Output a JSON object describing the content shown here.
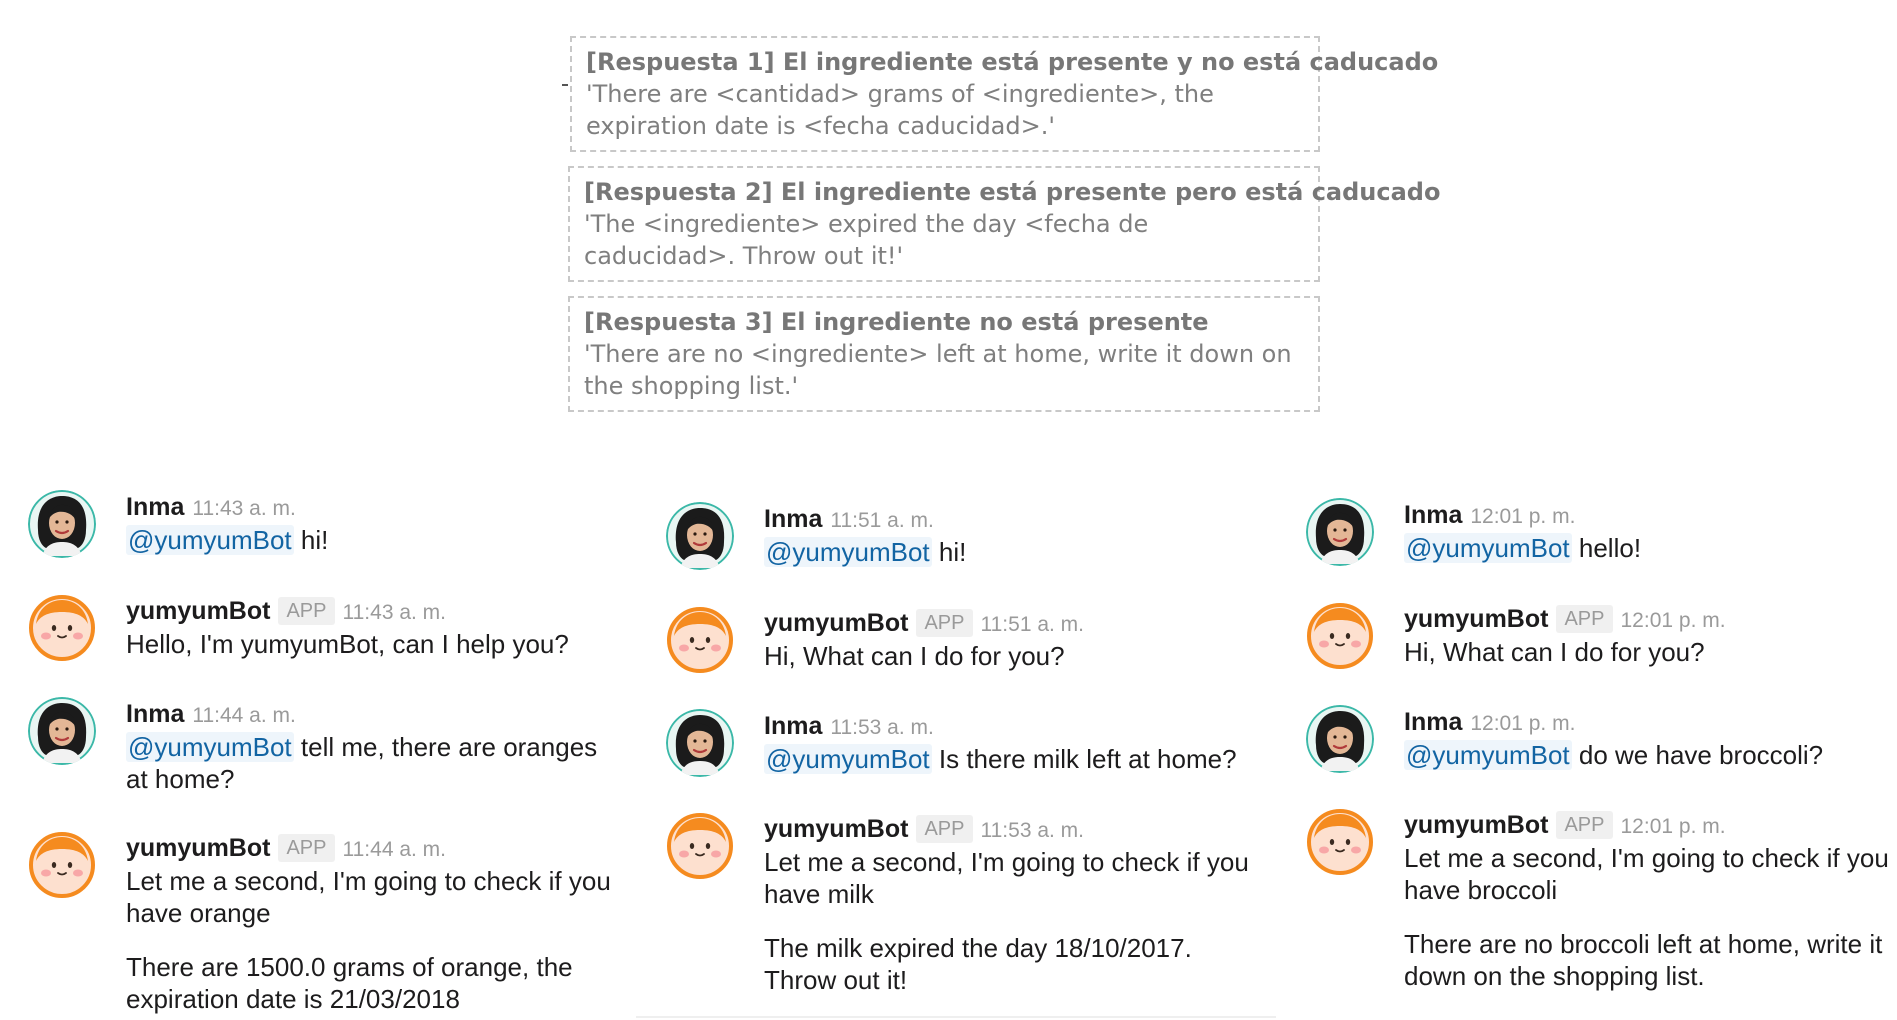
{
  "responses": [
    {
      "title": "[Respuesta 1] El ingrediente está presente y no está caducado",
      "text": "'There are <cantidad> grams of <ingrediente>, the expiration date is <fecha caducidad>.'"
    },
    {
      "title": "[Respuesta 2] El ingrediente está presente pero está caducado",
      "text": "'The <ingrediente> expired the day <fecha de caducidad>. Throw out it!'"
    },
    {
      "title": "[Respuesta 3] El ingrediente no está presente",
      "text": "'There are no <ingrediente> left at home, write it down on the shopping list.'"
    }
  ],
  "colors": {
    "mention": "#1264a3",
    "mention_bg": "#eef5fb",
    "bot_avatar_ring": "#f58b1f",
    "user_avatar_ring": "#3bb8a8"
  },
  "chats": [
    {
      "messages": [
        {
          "avatar": "inma-avatar-icon",
          "name": "Inma",
          "time": "11:43 a. m.",
          "mention": "@yumyumBot",
          "text": " hi!"
        },
        {
          "avatar": "yumyumbot-avatar-icon",
          "name": "yumyumBot",
          "badge": "APP",
          "time": "11:43 a. m.",
          "text": "Hello, I'm yumyumBot, can I help you?"
        },
        {
          "avatar": "inma-avatar-icon",
          "name": "Inma",
          "time": "11:44 a. m.",
          "mention": "@yumyumBot",
          "text": " tell me, there are oranges at home?"
        },
        {
          "avatar": "yumyumbot-avatar-icon",
          "name": "yumyumBot",
          "badge": "APP",
          "time": "11:44 a. m.",
          "text": "Let me a second, I'm going to check if you have orange",
          "text2": "There are 1500.0 grams of orange, the expiration date is 21/03/2018"
        }
      ]
    },
    {
      "messages": [
        {
          "avatar": "inma-avatar-icon",
          "name": "Inma",
          "time": "11:51 a. m.",
          "mention": "@yumyumBot",
          "text": " hi!"
        },
        {
          "avatar": "yumyumbot-avatar-icon",
          "name": "yumyumBot",
          "badge": "APP",
          "time": "11:51 a. m.",
          "text": "Hi, What can I do for you?"
        },
        {
          "avatar": "inma-avatar-icon",
          "name": "Inma",
          "time": "11:53 a. m.",
          "mention": "@yumyumBot",
          "text": " Is there milk left at home?"
        },
        {
          "avatar": "yumyumbot-avatar-icon",
          "name": "yumyumBot",
          "badge": "APP",
          "time": "11:53 a. m.",
          "text": "Let me a second, I'm going to check if you have milk",
          "text2": "The milk expired the day 18/10/2017. Throw out it!"
        }
      ]
    },
    {
      "messages": [
        {
          "avatar": "inma-avatar-icon",
          "name": "Inma",
          "time": "12:01 p. m.",
          "mention": "@yumyumBot",
          "text": " hello!"
        },
        {
          "avatar": "yumyumbot-avatar-icon",
          "name": "yumyumBot",
          "badge": "APP",
          "time": "12:01 p. m.",
          "text": "Hi, What can I do for you?"
        },
        {
          "avatar": "inma-avatar-icon",
          "name": "Inma",
          "time": "12:01 p. m.",
          "mention": "@yumyumBot",
          "text": " do we have broccoli?"
        },
        {
          "avatar": "yumyumbot-avatar-icon",
          "name": "yumyumBot",
          "badge": "APP",
          "time": "12:01 p. m.",
          "text": "Let me a second, I'm going to check if you have broccoli",
          "text2": "There are no broccoli left at home, write it down on the shopping list."
        }
      ]
    }
  ]
}
